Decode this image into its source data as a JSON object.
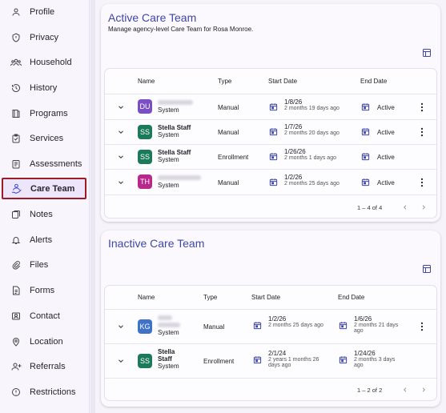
{
  "sidebar": {
    "items": [
      {
        "label": "Profile",
        "icon": "person-icon"
      },
      {
        "label": "Privacy",
        "icon": "shield-icon"
      },
      {
        "label": "Household",
        "icon": "people-icon"
      },
      {
        "label": "History",
        "icon": "history-icon"
      },
      {
        "label": "Programs",
        "icon": "book-icon"
      },
      {
        "label": "Services",
        "icon": "clipboard-check-icon"
      },
      {
        "label": "Assessments",
        "icon": "assessment-icon"
      },
      {
        "label": "Care Team",
        "icon": "care-team-icon",
        "active": true
      },
      {
        "label": "Notes",
        "icon": "notes-icon"
      },
      {
        "label": "Alerts",
        "icon": "bell-icon"
      },
      {
        "label": "Files",
        "icon": "paperclip-icon"
      },
      {
        "label": "Forms",
        "icon": "form-icon"
      },
      {
        "label": "Contact",
        "icon": "contact-card-icon"
      },
      {
        "label": "Location",
        "icon": "location-icon"
      },
      {
        "label": "Referrals",
        "icon": "add-person-icon"
      },
      {
        "label": "Restrictions",
        "icon": "alert-circle-icon"
      }
    ],
    "active_border_color": "#9b1c24"
  },
  "active": {
    "title": "Active Care Team",
    "subtitle": "Manage agency-level Care Team for Rosa Monroe.",
    "columns": {
      "name": "Name",
      "type": "Type",
      "start": "Start Date",
      "end": "End Date"
    },
    "rows": [
      {
        "initials": "DU",
        "avatar_color": "#7b4fc4",
        "name": "",
        "sub": "System",
        "type": "Manual",
        "start": "1/8/26",
        "start_ago": "2 months 19 days ago",
        "end": "Active"
      },
      {
        "initials": "SS",
        "avatar_color": "#1b7a5a",
        "name": "Stella Staff",
        "sub": "System",
        "type": "Manual",
        "start": "1/7/26",
        "start_ago": "2 months 20 days ago",
        "end": "Active"
      },
      {
        "initials": "SS",
        "avatar_color": "#1b7a5a",
        "name": "Stella Staff",
        "sub": "System",
        "type": "Enrollment",
        "start": "1/26/26",
        "start_ago": "2 months 1 days ago",
        "end": "Active"
      },
      {
        "initials": "TH",
        "avatar_color": "#b8288c",
        "name": "",
        "sub": "System",
        "type": "Manual",
        "start": "1/2/26",
        "start_ago": "2 months 25 days ago",
        "end": "Active"
      }
    ],
    "pagination": "1 – 4 of 4"
  },
  "inactive": {
    "title": "Inactive Care Team",
    "columns": {
      "name": "Name",
      "type": "Type",
      "start": "Start Date",
      "end": "End Date"
    },
    "rows": [
      {
        "initials": "KG",
        "avatar_color": "#3f72c9",
        "name": "",
        "sub": "System",
        "type": "Manual",
        "start": "1/2/26",
        "start_ago": "2 months 25 days ago",
        "end": "1/6/26",
        "end_ago": "2 months 21 days ago"
      },
      {
        "initials": "SS",
        "avatar_color": "#1b7a5a",
        "name": "Stella Staff",
        "sub": "System",
        "type": "Enrollment",
        "start": "2/1/24",
        "start_ago": "2 years 1 months 26 days ago",
        "end": "1/24/26",
        "end_ago": "2 months 3 days ago"
      }
    ],
    "pagination": "1 – 2 of 2"
  },
  "accent_color": "#3e46a8"
}
